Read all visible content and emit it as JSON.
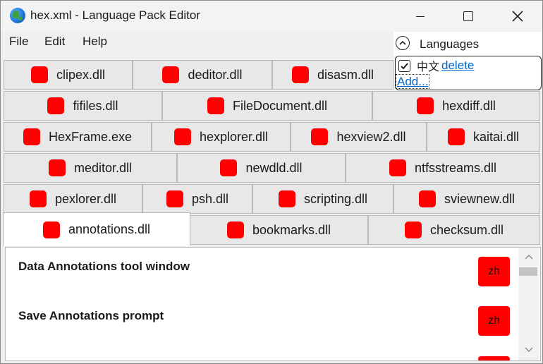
{
  "window": {
    "title": "hex.xml - Language Pack Editor",
    "icons": {
      "app": "globe-icon",
      "minimize": "minimize-icon",
      "maximize": "maximize-icon",
      "close": "close-icon"
    }
  },
  "menu": {
    "file": "File",
    "edit": "Edit",
    "help": "Help"
  },
  "languages": {
    "title": "Languages",
    "collapse_icon": "chevron-up-icon",
    "items": [
      {
        "name": "中文",
        "checked": true,
        "delete_label": "delete"
      }
    ],
    "add_label": "Add..."
  },
  "tabs": [
    [
      "clipex.dll",
      "deditor.dll",
      "disasm.dll"
    ],
    [
      "fifiles.dll",
      "FileDocument.dll",
      "hexdiff.dll"
    ],
    [
      "HexFrame.exe",
      "hexplorer.dll",
      "hexview2.dll",
      "kaitai.dll"
    ],
    [
      "meditor.dll",
      "newdld.dll",
      "ntfsstreams.dll"
    ],
    [
      "pexlorer.dll",
      "psh.dll",
      "scripting.dll",
      "sviewnew.dll"
    ],
    [
      "annotations.dll",
      "bookmarks.dll",
      "checksum.dll"
    ]
  ],
  "active_tab": "annotations.dll",
  "tab_marker_color": "#ff0000",
  "entries": [
    {
      "label": "Data Annotations tool window",
      "lang": "zh"
    },
    {
      "label": "Save Annotations prompt",
      "lang": "zh"
    }
  ],
  "colors": {
    "accent": "#ff0000",
    "link": "#0066cc"
  }
}
